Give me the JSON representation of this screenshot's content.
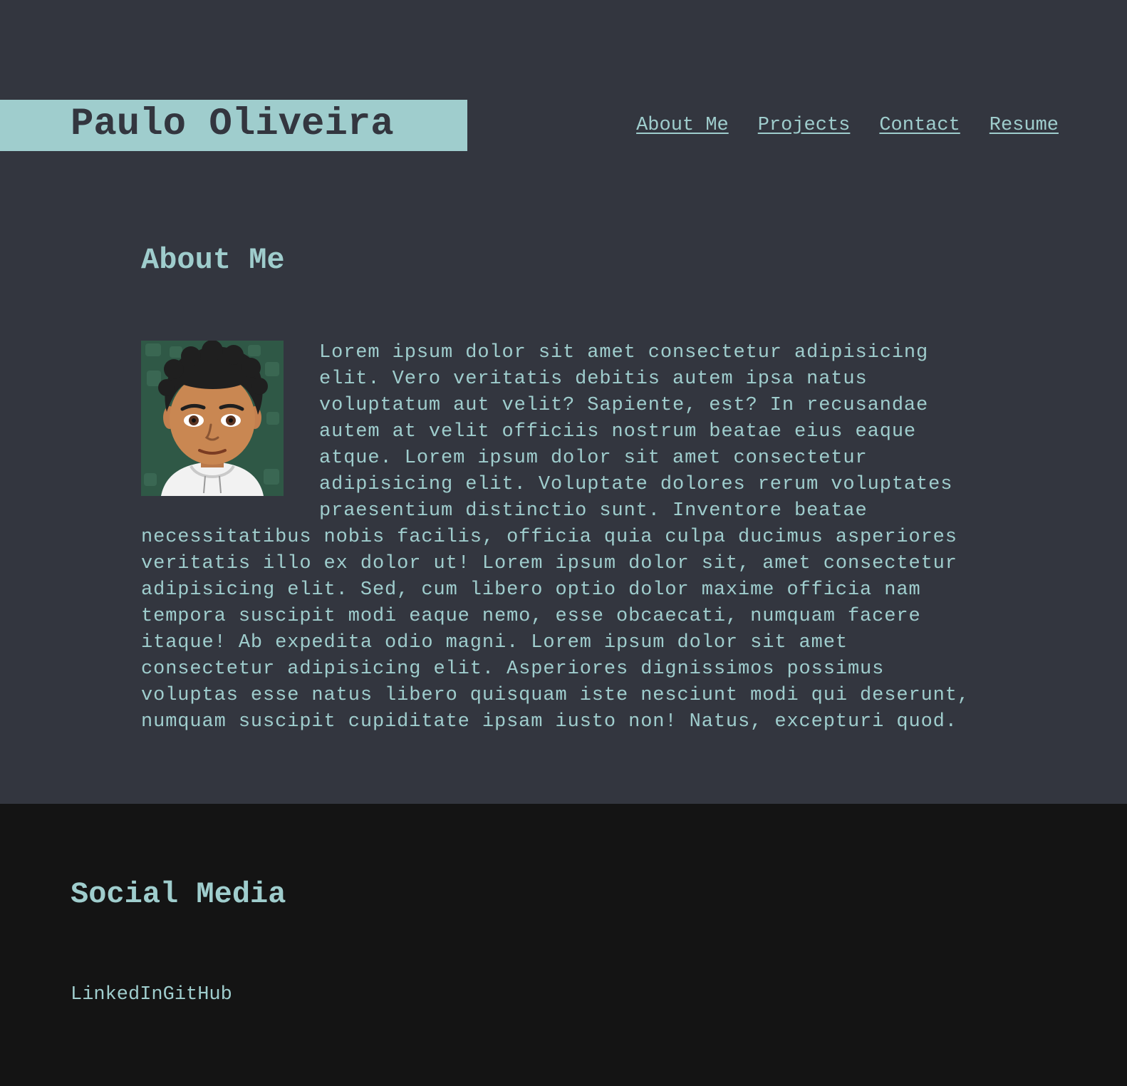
{
  "header": {
    "name": "Paulo Oliveira",
    "nav": [
      {
        "label": "About Me"
      },
      {
        "label": "Projects"
      },
      {
        "label": "Contact"
      },
      {
        "label": "Resume"
      }
    ]
  },
  "about": {
    "title": "About Me",
    "avatar_icon": "bitmoji-avatar-icon",
    "text": "Lorem ipsum dolor sit amet consectetur adipisicing elit. Vero veritatis debitis autem ipsa natus voluptatum aut velit? Sapiente, est? In recusandae autem at velit officiis nostrum beatae eius eaque atque. Lorem ipsum dolor sit amet consectetur adipisicing elit. Voluptate dolores rerum voluptates praesentium distinctio sunt. Inventore beatae necessitatibus nobis facilis, officia quia culpa ducimus asperiores veritatis illo ex dolor ut! Lorem ipsum dolor sit, amet consectetur adipisicing elit. Sed, cum libero optio dolor maxime officia nam tempora suscipit modi eaque nemo, esse obcaecati, numquam facere itaque! Ab expedita odio magni. Lorem ipsum dolor sit amet consectetur adipisicing elit. Asperiores dignissimos possimus voluptas esse natus libero quisquam iste nesciunt modi qui deserunt, numquam suscipit cupiditate ipsam iusto non! Natus, excepturi quod."
  },
  "footer": {
    "title": "Social Media",
    "links": [
      {
        "label": "LinkedIn"
      },
      {
        "label": "GitHub"
      }
    ]
  },
  "colors": {
    "page_bg": "#33363f",
    "accent": "#9fcdcd",
    "footer_bg": "#141414"
  }
}
